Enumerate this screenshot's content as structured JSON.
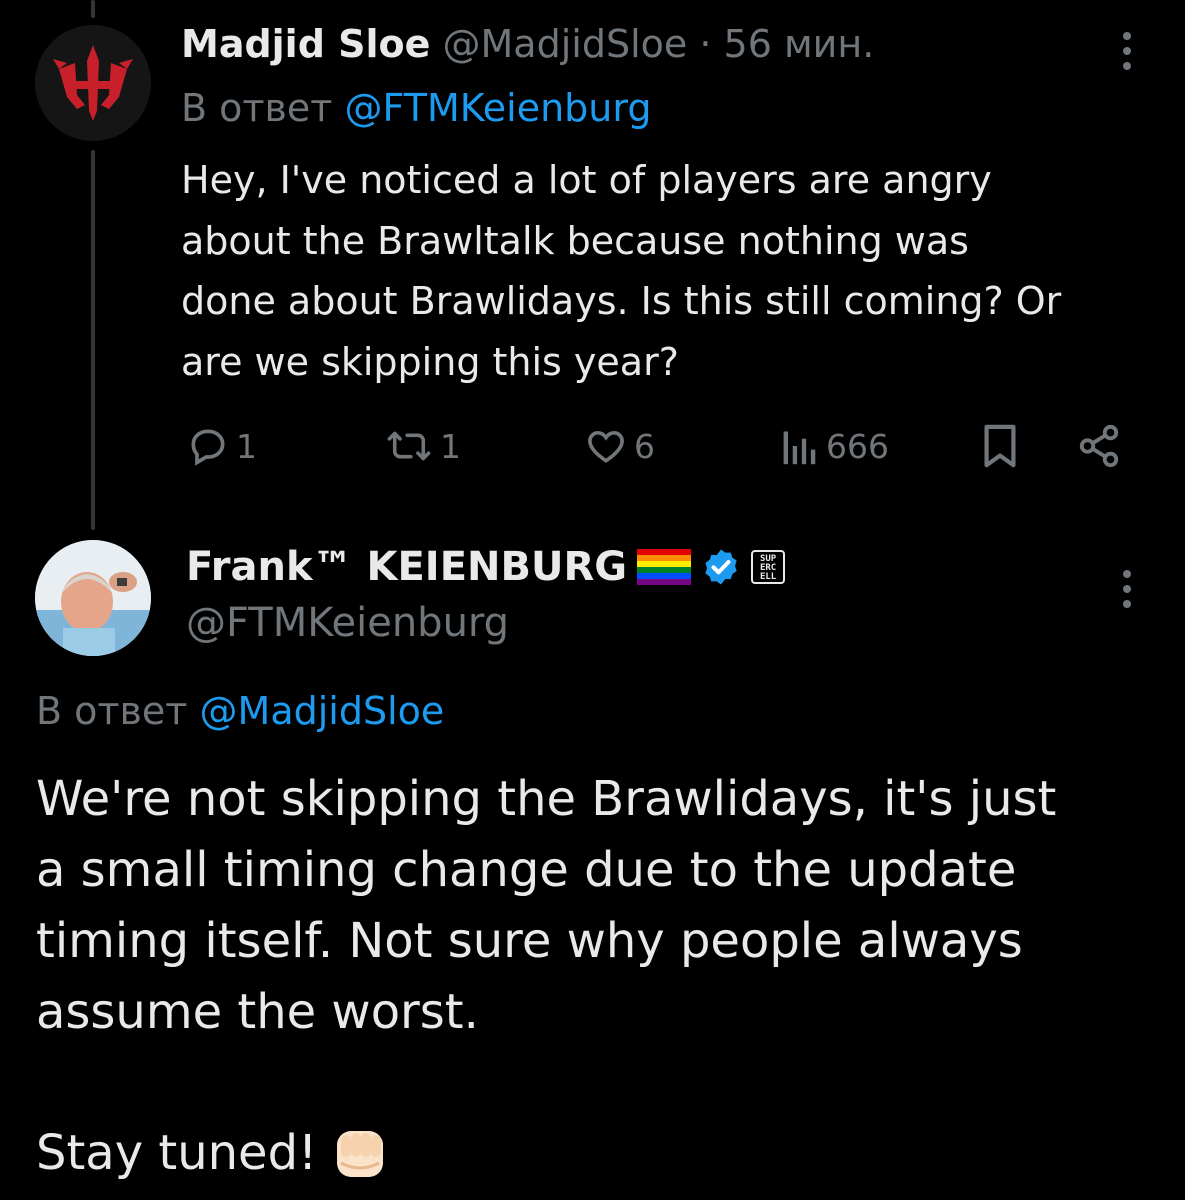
{
  "tweet1": {
    "display_name": "Madjid Sloe",
    "handle": "@MadjidSloe",
    "separator": "·",
    "time": "56 мин.",
    "reply_prefix": "В ответ",
    "reply_to": "@FTMKeienburg",
    "text_lines": [
      "Hey, I've noticed a lot of players are angry",
      "about the Brawltalk because nothing was",
      "done about Brawlidays. Is this still coming? Or",
      "are we skipping this year?"
    ],
    "actions": {
      "reply_count": "1",
      "retweet_count": "1",
      "like_count": "6",
      "view_count": "666"
    }
  },
  "tweet2": {
    "display_name": "Frank™ KEIENBURG",
    "handle": "@FTMKeienburg",
    "reply_prefix": "В ответ",
    "reply_to": "@MadjidSloe",
    "text_lines": [
      "We're not skipping the Brawlidays, it's just",
      "a small timing change due to the update",
      "timing itself. Not sure why people always",
      "assume the worst."
    ],
    "closing": "Stay tuned!",
    "closing_emoji": "fist-emoji",
    "affiliate_badge_text": [
      "SUP",
      "ERC",
      "ELL"
    ],
    "flag_icon": "rainbow-flag-icon",
    "verified_icon": "verified-badge-icon"
  },
  "colors": {
    "background": "#000000",
    "text": "#e7e9ea",
    "muted": "#71767b",
    "link": "#1d9bf0"
  }
}
